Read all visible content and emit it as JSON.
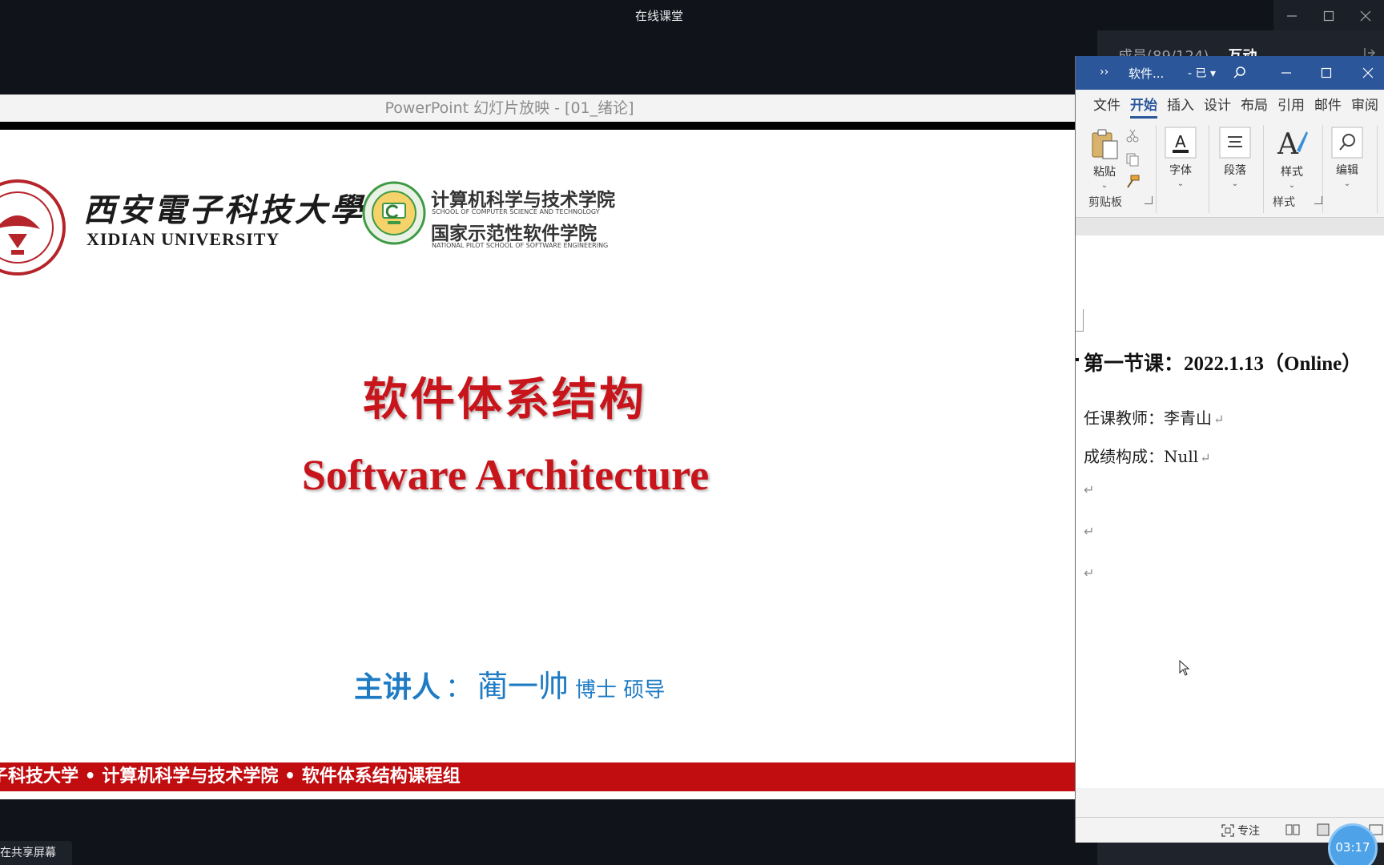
{
  "app": {
    "title": "在线课堂"
  },
  "side_panel": {
    "tabs": [
      {
        "label": "成员(89/124)"
      },
      {
        "label": "互动"
      }
    ]
  },
  "ppt": {
    "bar_title": "PowerPoint 幻灯片放映 - [01_绪论]",
    "logo_left_cn": "西安電子科技大學",
    "logo_left_en": "XIDIAN UNIVERSITY",
    "logo_right_cn1": "计算机科学与技术学院",
    "logo_right_en1": "SCHOOL OF COMPUTER SCIENCE AND TECHNOLOGY",
    "logo_right_cn2": "国家示范性软件学院",
    "logo_right_en2": "NATIONAL PILOT SCHOOL OF SOFTWARE ENGINEERING",
    "title_cn": "软件体系结构",
    "title_en": "Software Architecture",
    "presenter_label": "主讲人",
    "presenter_colon": "：",
    "presenter_name": "蔺一帅",
    "presenter_degree": "博士 硕导",
    "footer": "子科技大学 • 计算机科学与技术学院 • 软件体系结构课程组"
  },
  "word": {
    "doc_name": "软件...",
    "saved_status": "- 已 ▾",
    "menu": [
      {
        "label": "文件",
        "active": false
      },
      {
        "label": "开始",
        "active": true
      },
      {
        "label": "插入",
        "active": false
      },
      {
        "label": "设计",
        "active": false
      },
      {
        "label": "布局",
        "active": false
      },
      {
        "label": "引用",
        "active": false
      },
      {
        "label": "邮件",
        "active": false
      },
      {
        "label": "审阅",
        "active": false
      }
    ],
    "ribbon": {
      "paste": "粘贴",
      "clipboard_group": "剪贴板",
      "font": "字体",
      "paragraph": "段落",
      "styles": "样式",
      "styles_group": "样式",
      "editing": "编辑"
    },
    "doc": {
      "heading": "第一节课：2022.1.13（Online）",
      "teacher": "任课教师：李青山",
      "grade": "成绩构成：Null",
      "pilcrow": "↵"
    },
    "status": {
      "focus": "专注"
    }
  },
  "timer": "03:17",
  "share_tag": "在共享屏幕",
  "colors": {
    "accent_word": "#2b579a",
    "slide_red": "#c8141b",
    "presenter_blue": "#1e7bc4"
  }
}
